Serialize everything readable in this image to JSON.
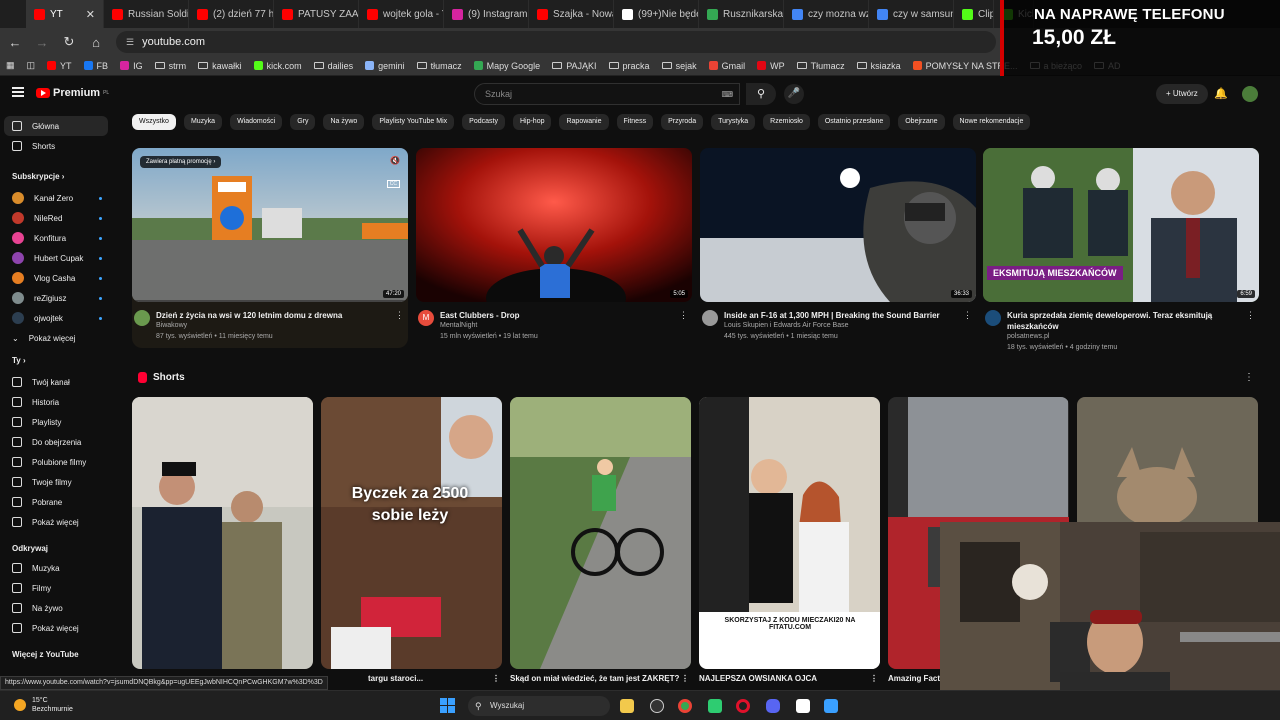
{
  "browser": {
    "tabs": [
      {
        "label": "YT",
        "color": "#ff0000",
        "active": true
      },
      {
        "label": "Russian Soldie",
        "color": "#ff0000"
      },
      {
        "label": "(2) dzień 77 ha",
        "color": "#ff0000"
      },
      {
        "label": "PATUSY ZAATA",
        "color": "#ff0000"
      },
      {
        "label": "wojtek gola - Y",
        "color": "#ff0000"
      },
      {
        "label": "(9) Instagram",
        "color": "#d6249f"
      },
      {
        "label": "Szajka - Nowa",
        "color": "#ff0000"
      },
      {
        "label": "(99+)Nie będę",
        "color": "#ffffff"
      },
      {
        "label": "Rusznikarska-L",
        "color": "#34a853"
      },
      {
        "label": "czy mozna wzi",
        "color": "#4285f4"
      },
      {
        "label": "czy w samsung",
        "color": "#4285f4"
      },
      {
        "label": "Clip",
        "color": "#53fc18"
      },
      {
        "label": "Kick",
        "color": "#53fc18"
      }
    ],
    "url": "youtube.com",
    "bookmarks": [
      {
        "label": "YT",
        "type": "yt"
      },
      {
        "label": "FB",
        "type": "fb"
      },
      {
        "label": "IG",
        "type": "ig"
      },
      {
        "label": "strm",
        "type": "folder"
      },
      {
        "label": "kawałki",
        "type": "folder"
      },
      {
        "label": "kick.com",
        "type": "kick"
      },
      {
        "label": "dailies",
        "type": "folder"
      },
      {
        "label": "gemini",
        "type": "gemini"
      },
      {
        "label": "tłumacz",
        "type": "folder"
      },
      {
        "label": "Mapy Google",
        "type": "maps"
      },
      {
        "label": "PAJĄKI",
        "type": "folder"
      },
      {
        "label": "pracka",
        "type": "folder"
      },
      {
        "label": "sejak",
        "type": "folder"
      },
      {
        "label": "Gmail",
        "type": "gmail"
      },
      {
        "label": "WP",
        "type": "wp"
      },
      {
        "label": "Tłumacz",
        "type": "folder"
      },
      {
        "label": "ksiazka",
        "type": "folder"
      },
      {
        "label": "POMYSŁY NA STRE...",
        "type": "ms"
      },
      {
        "label": "a bieżąco",
        "type": "folder"
      },
      {
        "label": "AD",
        "type": "folder"
      }
    ]
  },
  "overlay": {
    "line1": "NA NAPRAWĘ TELEFONU",
    "line2": "15,00 ZŁ"
  },
  "youtube": {
    "logo": "Premium",
    "logo_region": "PL",
    "search_placeholder": "Szukaj",
    "create_label": "Utwórz",
    "sidebar": {
      "main": [
        {
          "label": "Główna",
          "icon": "home-icon",
          "active": true
        },
        {
          "label": "Shorts",
          "icon": "shorts-icon"
        }
      ],
      "subs_title": "Subskrypcje",
      "subs": [
        {
          "label": "Kanał Zero",
          "color": "#d98c2b"
        },
        {
          "label": "NileRed",
          "color": "#c0392b"
        },
        {
          "label": "Konfitura",
          "color": "#e84393"
        },
        {
          "label": "Hubert Cupak",
          "color": "#8e44ad"
        },
        {
          "label": "Vlog Casha",
          "color": "#e67e22"
        },
        {
          "label": "reZigiusz",
          "color": "#7f8c8d"
        },
        {
          "label": "ojwojtek",
          "color": "#2c3e50"
        }
      ],
      "subs_more": "Pokaż więcej",
      "you_title": "Ty",
      "you": [
        {
          "label": "Twój kanał",
          "icon": "channel-icon"
        },
        {
          "label": "Historia",
          "icon": "history-icon"
        },
        {
          "label": "Playlisty",
          "icon": "playlist-icon"
        },
        {
          "label": "Do obejrzenia",
          "icon": "watch-later-icon"
        },
        {
          "label": "Polubione filmy",
          "icon": "like-icon"
        },
        {
          "label": "Twoje filmy",
          "icon": "your-videos-icon"
        },
        {
          "label": "Pobrane",
          "icon": "download-icon"
        },
        {
          "label": "Pokaż więcej",
          "icon": "chevron-down-icon"
        }
      ],
      "explore_title": "Odkrywaj",
      "explore": [
        {
          "label": "Muzyka",
          "icon": "music-icon"
        },
        {
          "label": "Filmy",
          "icon": "film-icon"
        },
        {
          "label": "Na żywo",
          "icon": "live-icon"
        },
        {
          "label": "Pokaż więcej",
          "icon": "chevron-down-icon"
        }
      ],
      "more_title": "Więcej z YouTube"
    },
    "chips": [
      "Wszystko",
      "Muzyka",
      "Wiadomości",
      "Gry",
      "Na żywo",
      "Playlisty YouTube Mix",
      "Podcasty",
      "Hip-hop",
      "Rapowanie",
      "Fitness",
      "Przyroda",
      "Turystyka",
      "Rzemiosło",
      "Ostatnio przesłane",
      "Obejrzane",
      "Nowe rekomendacje"
    ],
    "videos": [
      {
        "title": "Dzień z życia na wsi w 120 letnim domu z drewna",
        "channel": "Biwakowy",
        "stats": "87 tys. wyświetleń • 11 miesięcy temu",
        "duration": "47:20",
        "promo": "Zawiera płatną promocję",
        "avatar": "#6a994e"
      },
      {
        "title": "East Clubbers - Drop",
        "channel": "MentalNight",
        "stats": "15 mln wyświetleń • 19 lat temu",
        "duration": "5:05",
        "avatar": "#e74c3c",
        "avatar_letter": "M"
      },
      {
        "title": "Inside an F-16 at 1,300 MPH | Breaking the Sound Barrier",
        "channel": "Louis Skupien i Edwards Air Force Base",
        "stats": "445 tys. wyświetleń • 1 miesiąc temu",
        "duration": "36:33",
        "avatar": "#999999"
      },
      {
        "title": "Kuria sprzedała ziemię deweloperowi. Teraz eksmitują mieszkańców",
        "channel": "polsatnews.pl",
        "stats": "18 tys. wyświetleń • 4 godziny temu",
        "duration": "6:59",
        "banner": "EKSMITUJĄ MIESZKAŃCÓW",
        "avatar": "#1b4d7a"
      }
    ],
    "shorts_title": "Shorts",
    "shorts": [
      {
        "title": "",
        "overlay": ""
      },
      {
        "title": "targu staroci...",
        "overlay": "Byczek za 2500 sobie leży"
      },
      {
        "title": "Skąd on miał wiedzieć, że tam jest ZAKRĘT?",
        "overlay": ""
      },
      {
        "title": "NAJLEPSZA OWSIANKA OJCA",
        "overlay": "SKORZYSTAJ Z KODU MIECZAKI20 NA FITATU.COM"
      },
      {
        "title": "Amazing Fact",
        "overlay": ""
      },
      {
        "title": "",
        "overlay": ""
      }
    ]
  },
  "status_url": "https://www.youtube.com/watch?v=jsumdDNQBkg&pp=ugUEEgJwbNIHCQnPCwGHKGM7w%3D%3D",
  "taskbar": {
    "temp": "15°C",
    "weather": "Bezchmurnie",
    "search_label": "Wyszukaj"
  }
}
